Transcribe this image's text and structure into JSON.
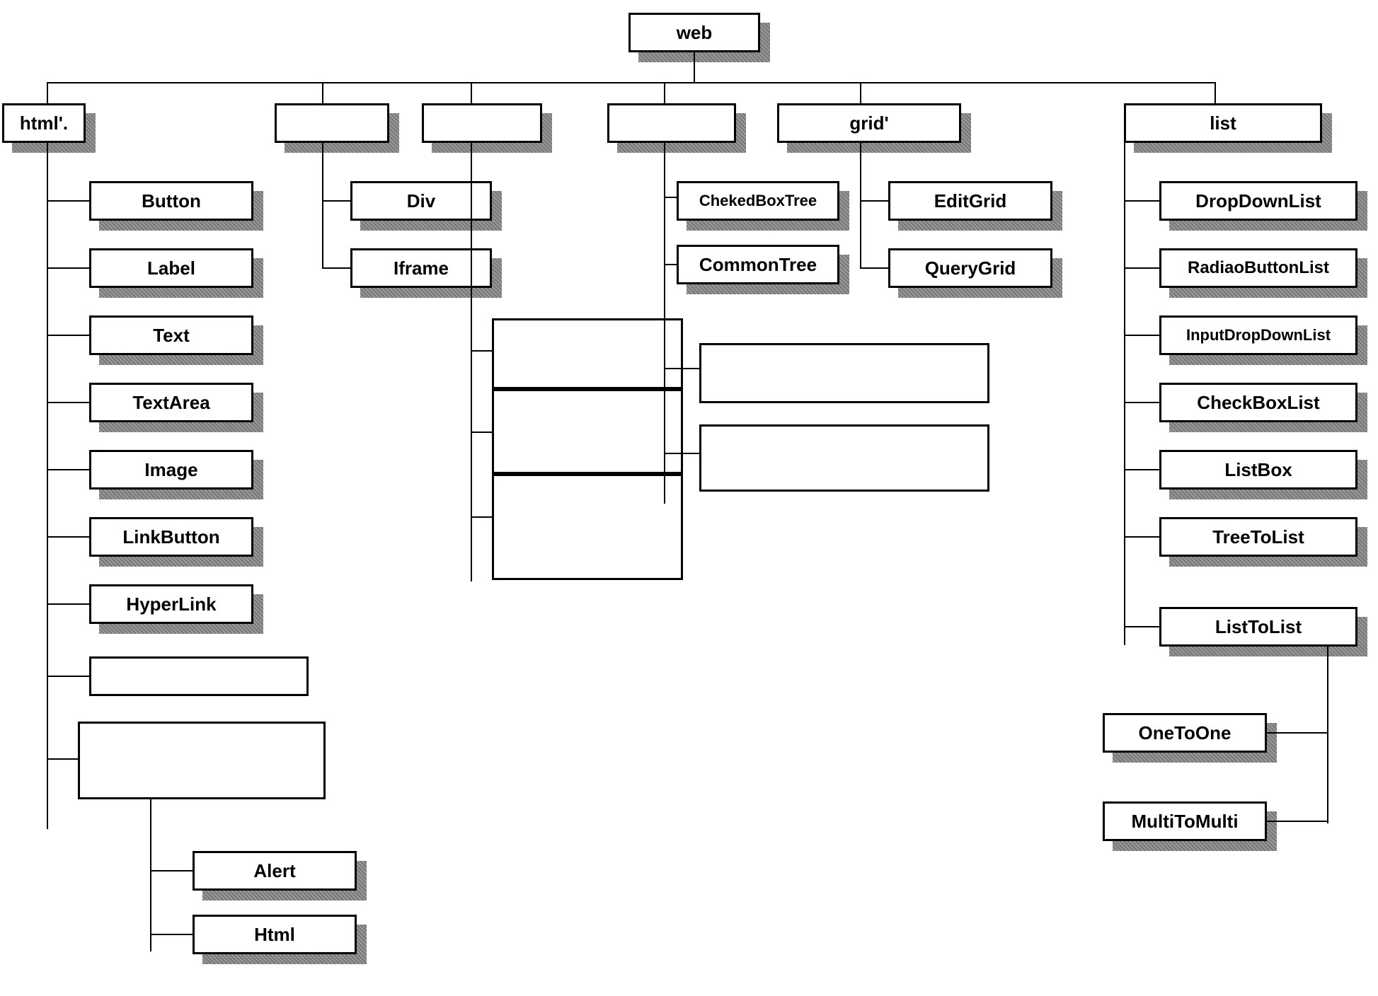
{
  "root": {
    "label": "web"
  },
  "level1": [
    {
      "id": "html",
      "label": "html'."
    },
    {
      "id": "cat2",
      "label": ""
    },
    {
      "id": "cat3",
      "label": ""
    },
    {
      "id": "cat4",
      "label": ""
    },
    {
      "id": "grid",
      "label": "grid'"
    },
    {
      "id": "list",
      "label": "list"
    }
  ],
  "html_children": [
    "Button",
    "Label",
    "Text",
    "TextArea",
    "Image",
    "LinkButton",
    "HyperLink",
    "",
    "",
    "Alert",
    "Html"
  ],
  "cat2_children": [
    "Div",
    "Iframe"
  ],
  "cat3_children": [
    "",
    "",
    ""
  ],
  "cat4_children_left": [
    "ChekedBoxTree",
    "CommonTree"
  ],
  "cat4_children_right": [
    "",
    ""
  ],
  "grid_children": [
    "EditGrid",
    "QueryGrid"
  ],
  "list_children": [
    "DropDownList",
    "RadiaoButtonList",
    "InputDropDownList",
    "CheckBoxList",
    "ListBox",
    "TreeToList",
    "ListToList"
  ],
  "listtolist_children": [
    "OneToOne",
    "MultiToMulti"
  ]
}
